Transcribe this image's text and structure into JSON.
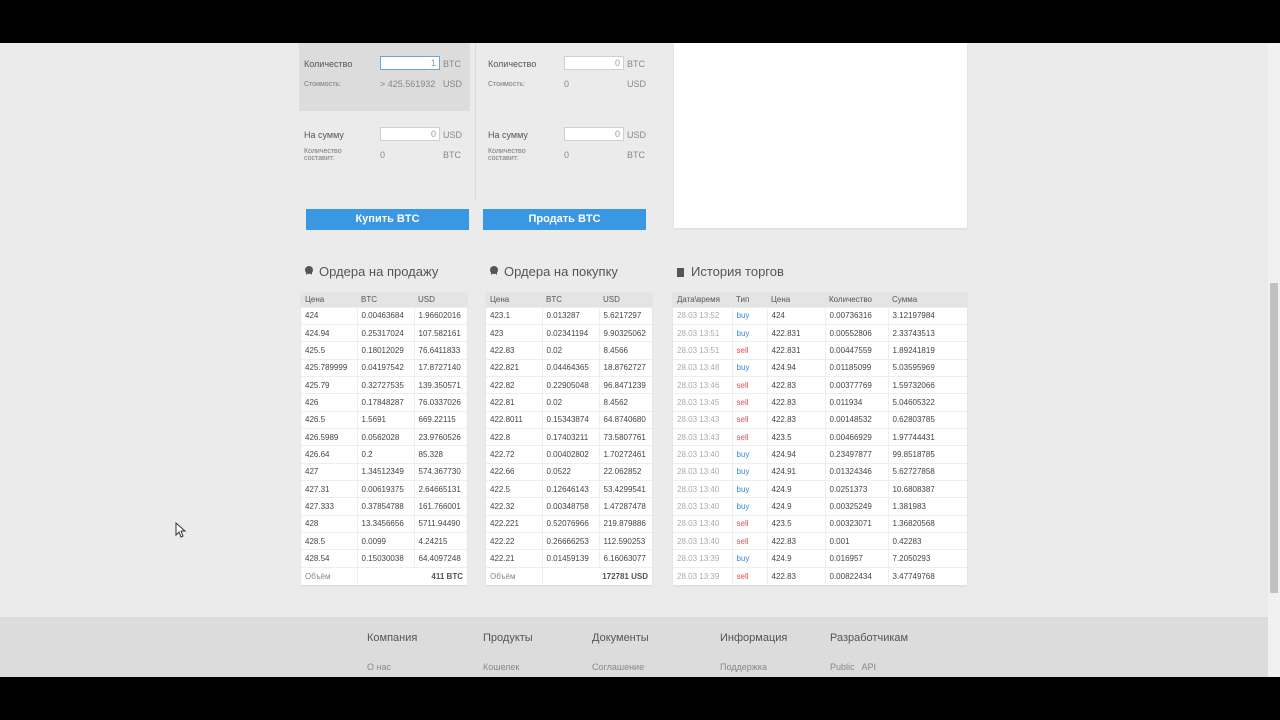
{
  "buy_form": {
    "qty_label": "Количество",
    "qty_value": "1",
    "qty_unit": "BTC",
    "cost_label": "Стоимость:",
    "cost_value": "> 425.561932",
    "cost_unit": "USD",
    "sum_label": "На сумму",
    "sum_value": "0",
    "sum_unit": "USD",
    "amount_label": "Количество составит:",
    "amount_value": "0",
    "amount_unit": "BTC",
    "button": "Купить BTC"
  },
  "sell_form": {
    "qty_label": "Количество",
    "qty_value": "0",
    "qty_unit": "BTC",
    "cost_label": "Стоимость:",
    "cost_value": "0",
    "cost_unit": "USD",
    "sum_label": "На сумму",
    "sum_value": "0",
    "sum_unit": "USD",
    "amount_label": "Количество составит:",
    "amount_value": "0",
    "amount_unit": "BTC",
    "button": "Продать BTC"
  },
  "sell_orders": {
    "title": "Ордера на продажу",
    "headers": [
      "Цена",
      "BTC",
      "USD"
    ],
    "rows": [
      [
        "424",
        "0.00463684",
        "1.96602016"
      ],
      [
        "424.94",
        "0.25317024",
        "107.582161"
      ],
      [
        "425.5",
        "0.18012029",
        "76.6411833"
      ],
      [
        "425.789999",
        "0.04197542",
        "17.8727140"
      ],
      [
        "425.79",
        "0.32727535",
        "139.350571"
      ],
      [
        "426",
        "0.17848287",
        "76.0337026"
      ],
      [
        "426.5",
        "1.5691",
        "669.22115"
      ],
      [
        "426.5989",
        "0.0562028",
        "23.9760526"
      ],
      [
        "426.64",
        "0.2",
        "85.328"
      ],
      [
        "427",
        "1.34512349",
        "574.367730"
      ],
      [
        "427.31",
        "0.00619375",
        "2.64665131"
      ],
      [
        "427.333",
        "0.37854788",
        "161.766001"
      ],
      [
        "428",
        "13.3456656",
        "5711.94490"
      ],
      [
        "428.5",
        "0.0099",
        "4.24215"
      ],
      [
        "428.54",
        "0.15030038",
        "64.4097248"
      ]
    ],
    "volume_label": "Объём",
    "volume_value": "411 BTC"
  },
  "buy_orders": {
    "title": "Ордера на покупку",
    "headers": [
      "Цена",
      "BTC",
      "USD"
    ],
    "rows": [
      [
        "423.1",
        "0.013287",
        "5.6217297"
      ],
      [
        "423",
        "0.02341194",
        "9.90325062"
      ],
      [
        "422.83",
        "0.02",
        "8.4566"
      ],
      [
        "422.821",
        "0.04464365",
        "18.8762727"
      ],
      [
        "422.82",
        "0.22905048",
        "96.8471239"
      ],
      [
        "422.81",
        "0.02",
        "8.4562"
      ],
      [
        "422.8011",
        "0.15343874",
        "64.8740680"
      ],
      [
        "422.8",
        "0.17403211",
        "73.5807761"
      ],
      [
        "422.72",
        "0.00402802",
        "1.70272461"
      ],
      [
        "422.66",
        "0.0522",
        "22.062852"
      ],
      [
        "422.5",
        "0.12646143",
        "53.4299541"
      ],
      [
        "422.32",
        "0.00348758",
        "1.47287478"
      ],
      [
        "422.221",
        "0.52076966",
        "219.879886"
      ],
      [
        "422.22",
        "0.26666253",
        "112.590253"
      ],
      [
        "422.21",
        "0.01459139",
        "6.16063077"
      ]
    ],
    "volume_label": "Объём",
    "volume_value": "172781 USD"
  },
  "trade_history": {
    "title": "История торгов",
    "headers": [
      "Дата\\время",
      "Тип",
      "Цена",
      "Количество",
      "Сумма"
    ],
    "rows": [
      [
        "28.03 13:52",
        "buy",
        "424",
        "0.00736316",
        "3.12197984"
      ],
      [
        "28.03 13:51",
        "buy",
        "422.831",
        "0.00552806",
        "2.33743513"
      ],
      [
        "28.03 13:51",
        "sell",
        "422.831",
        "0.00447559",
        "1.89241819"
      ],
      [
        "28.03 13:48",
        "buy",
        "424.94",
        "0.01185099",
        "5.03595969"
      ],
      [
        "28.03 13:46",
        "sell",
        "422.83",
        "0.00377769",
        "1.59732066"
      ],
      [
        "28.03 13:45",
        "sell",
        "422.83",
        "0.011934",
        "5.04605322"
      ],
      [
        "28.03 13:43",
        "sell",
        "422.83",
        "0.00148532",
        "0.62803785"
      ],
      [
        "28.03 13:43",
        "sell",
        "423.5",
        "0.00466929",
        "1.97744431"
      ],
      [
        "28.03 13:40",
        "buy",
        "424.94",
        "0.23497877",
        "99.8518785"
      ],
      [
        "28.03 13:40",
        "buy",
        "424.91",
        "0.01324346",
        "5.62727858"
      ],
      [
        "28.03 13:40",
        "buy",
        "424.9",
        "0.0251373",
        "10.6808387"
      ],
      [
        "28.03 13:40",
        "buy",
        "424.9",
        "0.00325249",
        "1.381983"
      ],
      [
        "28.03 13:40",
        "sell",
        "423.5",
        "0.00323071",
        "1.36820568"
      ],
      [
        "28.03 13:40",
        "sell",
        "422.83",
        "0.001",
        "0.42283"
      ],
      [
        "28.03 13:39",
        "buy",
        "424.9",
        "0.016957",
        "7.2050293"
      ],
      [
        "28.03 13:39",
        "sell",
        "422.83",
        "0.00822434",
        "3.47749768"
      ]
    ]
  },
  "footer": {
    "columns": [
      {
        "head": "Компания",
        "link": "О нас"
      },
      {
        "head": "Продукты",
        "link": "Кошелек"
      },
      {
        "head": "Документы",
        "link": "Соглашение"
      },
      {
        "head": "Информация",
        "link": "Поддержка"
      },
      {
        "head": "Разработчикам",
        "link": "Public   API"
      }
    ]
  }
}
